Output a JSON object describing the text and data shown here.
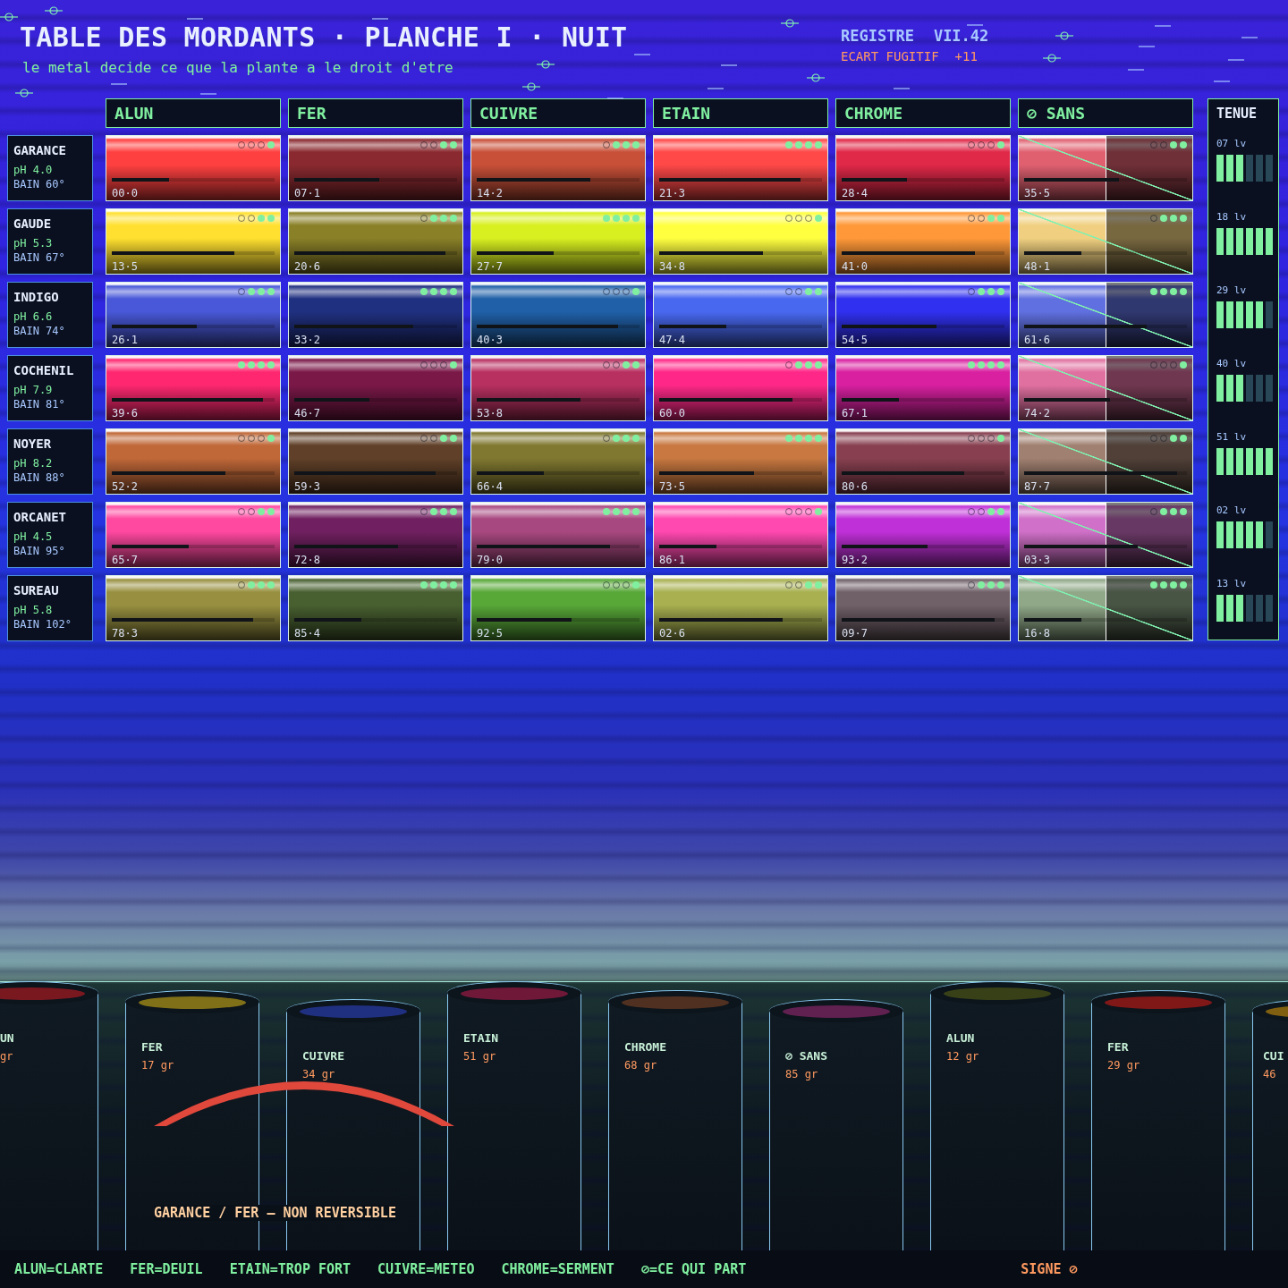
{
  "header": {
    "title": "TABLE DES MORDANTS · PLANCHE I · NUIT",
    "subtitle": "le metal decide ce que la plante a le droit d'etre",
    "register_label": "REGISTRE",
    "register_value": "VII.42",
    "drift_label": "ECART FUGITIF",
    "drift_value": "+11"
  },
  "columns": [
    {
      "label": "ALUN",
      "kind": "mordant"
    },
    {
      "label": "FER",
      "kind": "mordant"
    },
    {
      "label": "CUIVRE",
      "kind": "mordant"
    },
    {
      "label": "ETAIN",
      "kind": "mordant"
    },
    {
      "label": "CHROME",
      "kind": "mordant"
    },
    {
      "label": "⊘ SANS",
      "kind": "none"
    }
  ],
  "tenue_title": "TENUE",
  "rows": [
    {
      "name": "GARANCE",
      "ph": "pH 4.0",
      "bain": "BAIN 60°",
      "tenue": "07 lv",
      "level": 0.5,
      "swatches": [
        {
          "color": "#ff4040",
          "stars": 1,
          "level": 0.35,
          "code": "00·0"
        },
        {
          "color": "#8a2a30",
          "stars": 2,
          "level": 0.52,
          "code": "07·1"
        },
        {
          "color": "#c85038",
          "stars": 3,
          "level": 0.7,
          "code": "14·2"
        },
        {
          "color": "#ff4848",
          "stars": 4,
          "level": 0.87,
          "code": "21·3"
        },
        {
          "color": "#e02848",
          "stars": 1,
          "level": 0.4,
          "code": "28·4"
        },
        {
          "color": "#e06070",
          "stars": 2,
          "level": 0.58,
          "code": "35·5"
        }
      ]
    },
    {
      "name": "GAUDE",
      "ph": "pH 5.3",
      "bain": "BAIN 67°",
      "tenue": "18 lv",
      "level": 1,
      "swatches": [
        {
          "color": "#ffe030",
          "stars": 2,
          "level": 0.75,
          "code": "13·5"
        },
        {
          "color": "#8a8028",
          "stars": 3,
          "level": 0.93,
          "code": "20·6"
        },
        {
          "color": "#d8f020",
          "stars": 4,
          "level": 0.47,
          "code": "27·7"
        },
        {
          "color": "#ffff40",
          "stars": 1,
          "level": 0.64,
          "code": "34·8"
        },
        {
          "color": "#ff9838",
          "stars": 2,
          "level": 0.82,
          "code": "41·0"
        },
        {
          "color": "#f0d080",
          "stars": 3,
          "level": 0.35,
          "code": "48·1"
        }
      ]
    },
    {
      "name": "INDIGO",
      "ph": "pH 6.6",
      "bain": "BAIN 74°",
      "tenue": "29 lv",
      "level": 0.83,
      "swatches": [
        {
          "color": "#4858d8",
          "stars": 3,
          "level": 0.52,
          "code": "26·1"
        },
        {
          "color": "#203080",
          "stars": 4,
          "level": 0.73,
          "code": "33·2"
        },
        {
          "color": "#2060a8",
          "stars": 1,
          "level": 0.87,
          "code": "40·3"
        },
        {
          "color": "#4868f0",
          "stars": 2,
          "level": 0.41,
          "code": "47·4"
        },
        {
          "color": "#3030f0",
          "stars": 3,
          "level": 0.58,
          "code": "54·5"
        },
        {
          "color": "#6070e0",
          "stars": 4,
          "level": 0.75,
          "code": "61·6"
        }
      ]
    },
    {
      "name": "COCHENIL",
      "ph": "pH 7.9",
      "bain": "BAIN 81°",
      "tenue": "40 lv",
      "level": 0.5,
      "swatches": [
        {
          "color": "#ff2870",
          "stars": 4,
          "level": 0.93,
          "code": "39·6"
        },
        {
          "color": "#7a1848",
          "stars": 1,
          "level": 0.46,
          "code": "46·7"
        },
        {
          "color": "#b83060",
          "stars": 2,
          "level": 0.64,
          "code": "53·8"
        },
        {
          "color": "#ff2888",
          "stars": 3,
          "level": 0.82,
          "code": "60·0"
        },
        {
          "color": "#d820a0",
          "stars": 4,
          "level": 0.35,
          "code": "67·1"
        },
        {
          "color": "#e070a0",
          "stars": 1,
          "level": 0.53,
          "code": "74·2"
        }
      ]
    },
    {
      "name": "NOYER",
      "ph": "pH 8.2",
      "bain": "BAIN 88°",
      "tenue": "51 lv",
      "level": 1,
      "swatches": [
        {
          "color": "#c06838",
          "stars": 1,
          "level": 0.7,
          "code": "52·2"
        },
        {
          "color": "#604028",
          "stars": 2,
          "level": 0.87,
          "code": "59·3"
        },
        {
          "color": "#807830",
          "stars": 3,
          "level": 0.41,
          "code": "66·4"
        },
        {
          "color": "#c87840",
          "stars": 4,
          "level": 0.58,
          "code": "73·5"
        },
        {
          "color": "#884050",
          "stars": 1,
          "level": 0.75,
          "code": "80·6"
        },
        {
          "color": "#a08070",
          "stars": 2,
          "level": 0.94,
          "code": "87·7"
        }
      ]
    },
    {
      "name": "ORCANET",
      "ph": "pH 4.5",
      "bain": "BAIN 95°",
      "tenue": "02 lv",
      "level": 0.83,
      "swatches": [
        {
          "color": "#ff48a0",
          "stars": 2,
          "level": 0.47,
          "code": "65·7"
        },
        {
          "color": "#702060",
          "stars": 3,
          "level": 0.64,
          "code": "72·8"
        },
        {
          "color": "#a84880",
          "stars": 4,
          "level": 0.82,
          "code": "79·0"
        },
        {
          "color": "#ff48b0",
          "stars": 1,
          "level": 0.35,
          "code": "86·1"
        },
        {
          "color": "#c030d8",
          "stars": 2,
          "level": 0.53,
          "code": "93·2"
        },
        {
          "color": "#d070c8",
          "stars": 3,
          "level": 0.7,
          "code": "03·3"
        }
      ]
    },
    {
      "name": "SUREAU",
      "ph": "pH 5.8",
      "bain": "BAIN 102°",
      "tenue": "13 lv",
      "level": 0.5,
      "swatches": [
        {
          "color": "#989040",
          "stars": 3,
          "level": 0.87,
          "code": "78·3"
        },
        {
          "color": "#486030",
          "stars": 4,
          "level": 0.41,
          "code": "85·4"
        },
        {
          "color": "#58a838",
          "stars": 1,
          "level": 0.58,
          "code": "92·5"
        },
        {
          "color": "#a8b050",
          "stars": 2,
          "level": 0.76,
          "code": "02·6"
        },
        {
          "color": "#706068",
          "stars": 3,
          "level": 0.94,
          "code": "09·7"
        },
        {
          "color": "#90a888",
          "stars": 4,
          "level": 0.35,
          "code": "16·8"
        }
      ]
    }
  ],
  "vats": [
    {
      "label": "UN",
      "weight": "gr",
      "color": "#7a1820"
    },
    {
      "label": "FER",
      "weight": "17 gr",
      "color": "#807018"
    },
    {
      "label": "CUIVRE",
      "weight": "34 gr",
      "color": "#203080"
    },
    {
      "label": "ETAIN",
      "weight": "51 gr",
      "color": "#701838"
    },
    {
      "label": "CHROME",
      "weight": "68 gr",
      "color": "#503020"
    },
    {
      "label": "⊘ SANS",
      "weight": "85 gr",
      "color": "#602050"
    },
    {
      "label": "ALUN",
      "weight": "12 gr",
      "color": "#384018"
    },
    {
      "label": "FER",
      "weight": "29 gr",
      "color": "#801818"
    },
    {
      "label": "CUI",
      "weight": "46",
      "color": "#806010"
    }
  ],
  "bridge_label": "GARANCE / FER — NON REVERSIBLE",
  "legend": [
    "ALUN=CLARTE",
    "FER=DEUIL",
    "ETAIN=TROP FORT",
    "CUIVRE=METEO",
    "CHROME=SERMENT",
    "⊘=CE QUI PART"
  ],
  "signature": "SIGNE ⊘"
}
